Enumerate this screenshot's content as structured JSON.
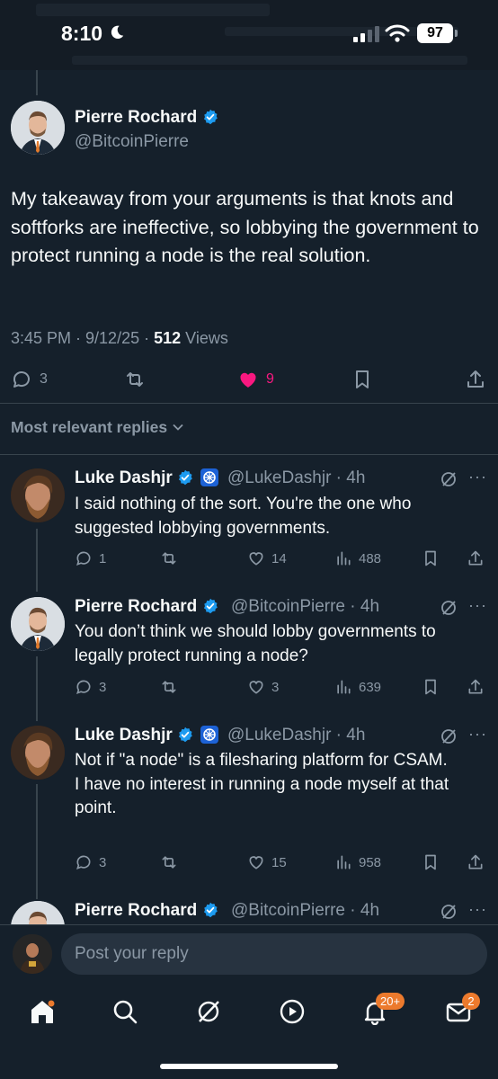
{
  "status_bar": {
    "time": "8:10",
    "battery": "97"
  },
  "main_tweet": {
    "author_name": "Pierre Rochard",
    "author_handle": "@BitcoinPierre",
    "text": "My takeaway from your arguments is that knots and softforks are ineffective, so lobbying the government to protect running a node is the real solution.",
    "timestamp": "3:45 PM · 9/12/25 · ",
    "views_count": "512",
    "views_label": " Views",
    "replies": "3",
    "likes": "9"
  },
  "replies_header": "Most relevant replies",
  "replies": [
    {
      "name": "Luke Dashjr",
      "handle": "@LukeDashjr · 4h",
      "text": "I said nothing of the sort. You're the one who suggested lobbying governments.",
      "replies": "1",
      "likes": "14",
      "views": "488"
    },
    {
      "name": "Pierre Rochard",
      "handle": "@BitcoinPierre · 4h",
      "text": "You don’t think we should lobby governments to legally protect running a node?",
      "replies": "3",
      "likes": "3",
      "views": "639"
    },
    {
      "name": "Luke Dashjr",
      "handle": "@LukeDashjr · 4h",
      "text_lines": [
        "Not if \"a node\" is a filesharing platform for CSAM.",
        "I have no interest in running a node myself at that point."
      ],
      "replies": "3",
      "likes": "15",
      "views": "958"
    },
    {
      "name": "Pierre Rochard",
      "handle": "@BitcoinPierre · 4h"
    }
  ],
  "reply_bar": {
    "placeholder": "Post your reply"
  },
  "tab_bar": {
    "notifications_badge": "20+",
    "messages_badge": "2"
  },
  "colors": {
    "background": "#15202b",
    "like": "#f91880",
    "verified": "#1d9bf0",
    "badge": "#ec7a2d"
  }
}
